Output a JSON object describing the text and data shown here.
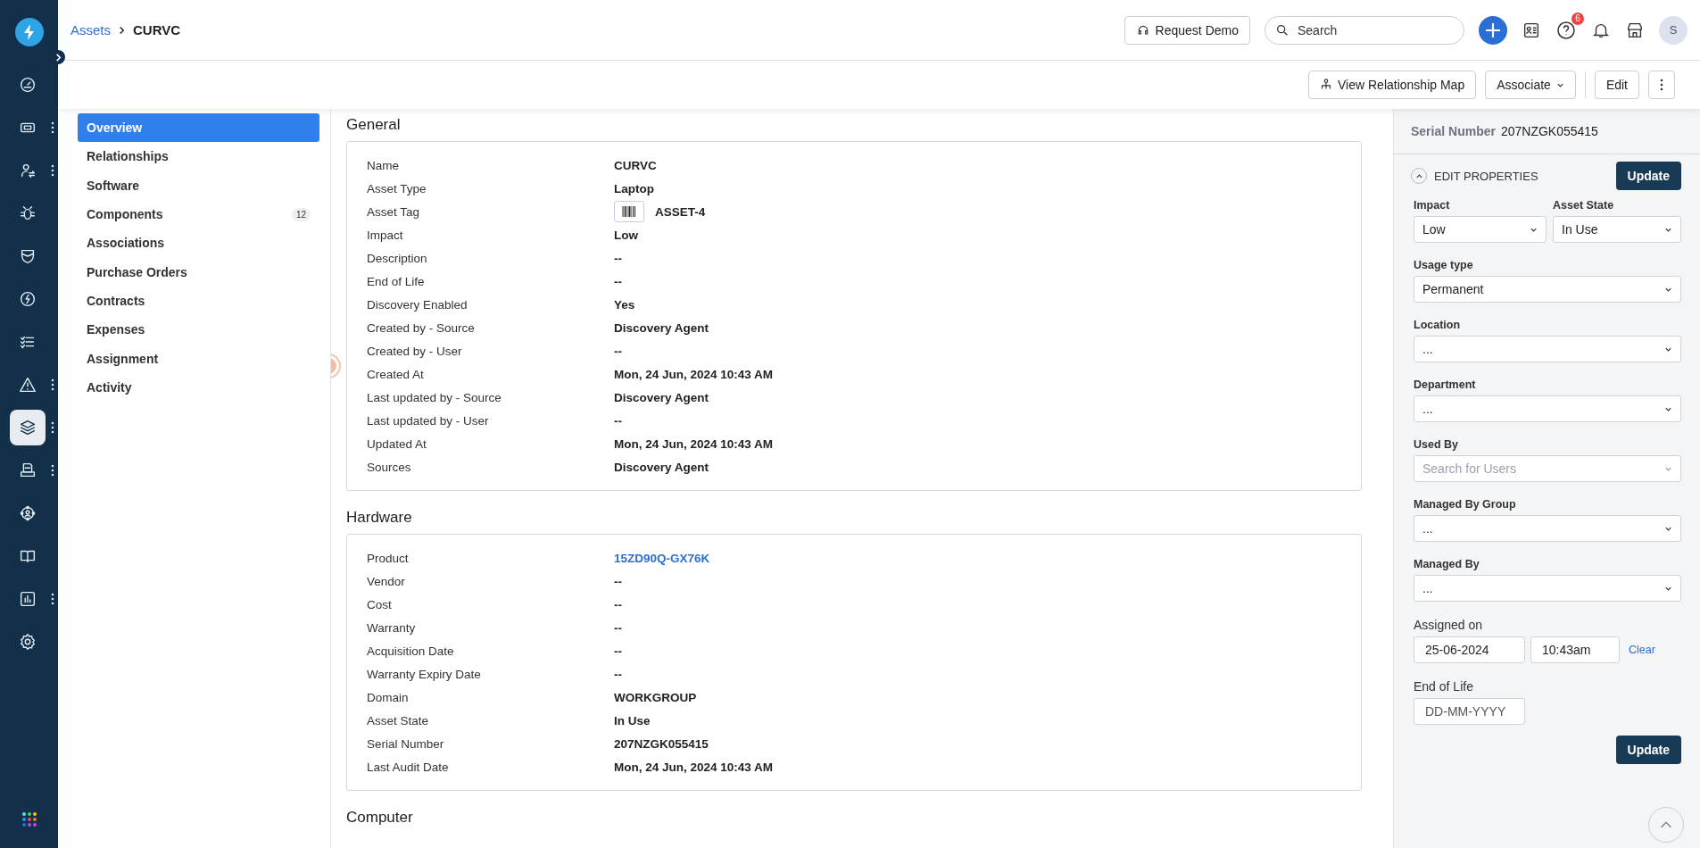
{
  "rail": {
    "items": [
      {
        "selected": false,
        "has_menu": false
      },
      {
        "selected": false,
        "has_menu": true
      },
      {
        "selected": false,
        "has_menu": true
      },
      {
        "selected": false,
        "has_menu": false
      },
      {
        "selected": false,
        "has_menu": false
      },
      {
        "selected": false,
        "has_menu": false
      },
      {
        "selected": false,
        "has_menu": false
      },
      {
        "selected": false,
        "has_menu": true
      },
      {
        "selected": true,
        "has_menu": true
      },
      {
        "selected": false,
        "has_menu": true
      },
      {
        "selected": false,
        "has_menu": false
      },
      {
        "selected": false,
        "has_menu": false
      },
      {
        "selected": false,
        "has_menu": true
      },
      {
        "selected": false,
        "has_menu": false
      }
    ]
  },
  "breadcrumb": [
    {
      "label": "Assets",
      "kind": "link"
    },
    {
      "label": "CURVC",
      "kind": "current"
    }
  ],
  "header": {
    "request_demo": "Request Demo",
    "search": {
      "placeholder": "Search"
    },
    "help_badge": "6",
    "avatar": "S"
  },
  "toolbar": {
    "buttons": [
      "View Relationship Map",
      "Associate",
      "Edit"
    ]
  },
  "subnav": [
    {
      "label": "Overview",
      "selected": true
    },
    {
      "label": "Relationships",
      "selected": false
    },
    {
      "label": "Software",
      "selected": false
    },
    {
      "label": "Components",
      "selected": false,
      "count": "12"
    },
    {
      "label": "Associations",
      "selected": false
    },
    {
      "label": "Purchase Orders",
      "selected": false
    },
    {
      "label": "Contracts",
      "selected": false
    },
    {
      "label": "Expenses",
      "selected": false
    },
    {
      "label": "Assignment",
      "selected": false
    },
    {
      "label": "Activity",
      "selected": false
    }
  ],
  "sections": [
    {
      "title": "General",
      "rows": [
        {
          "label": "Name",
          "value": "CURVC",
          "kind": "text"
        },
        {
          "label": "Asset Type",
          "value": "Laptop",
          "kind": "text"
        },
        {
          "label": "Asset Tag",
          "value": "ASSET-4",
          "kind": "tag"
        },
        {
          "label": "Impact",
          "value": "Low",
          "kind": "text"
        },
        {
          "label": "Description",
          "value": "--",
          "kind": "text"
        },
        {
          "label": "End of Life",
          "value": "--",
          "kind": "text"
        },
        {
          "label": "Discovery Enabled",
          "value": "Yes",
          "kind": "text"
        },
        {
          "label": "Created by - Source",
          "value": "Discovery Agent",
          "kind": "text"
        },
        {
          "label": "Created by - User",
          "value": "--",
          "kind": "text"
        },
        {
          "label": "Created At",
          "value": "Mon, 24 Jun, 2024 10:43 AM",
          "kind": "text"
        },
        {
          "label": "Last updated by - Source",
          "value": "Discovery Agent",
          "kind": "text"
        },
        {
          "label": "Last updated by - User",
          "value": "--",
          "kind": "text"
        },
        {
          "label": "Updated At",
          "value": "Mon, 24 Jun, 2024 10:43 AM",
          "kind": "text"
        },
        {
          "label": "Sources",
          "value": "Discovery Agent",
          "kind": "text"
        }
      ]
    },
    {
      "title": "Hardware",
      "rows": [
        {
          "label": "Product",
          "value": "15ZD90Q-GX76K",
          "kind": "link"
        },
        {
          "label": "Vendor",
          "value": "--",
          "kind": "text"
        },
        {
          "label": "Cost",
          "value": "--",
          "kind": "text"
        },
        {
          "label": "Warranty",
          "value": "--",
          "kind": "text"
        },
        {
          "label": "Acquisition Date",
          "value": "--",
          "kind": "text"
        },
        {
          "label": "Warranty Expiry Date",
          "value": "--",
          "kind": "text"
        },
        {
          "label": "Domain",
          "value": "WORKGROUP",
          "kind": "text"
        },
        {
          "label": "Asset State",
          "value": "In Use",
          "kind": "text"
        },
        {
          "label": "Serial Number",
          "value": "207NZGK055415",
          "kind": "text"
        },
        {
          "label": "Last Audit Date",
          "value": "Mon, 24 Jun, 2024 10:43 AM",
          "kind": "text"
        }
      ]
    },
    {
      "title": "Computer"
    }
  ],
  "panel": {
    "serial_label": "Serial Number",
    "serial_value": "207NZGK055415",
    "edit_title": "EDIT PROPERTIES",
    "update": "Update",
    "fields": [
      {
        "kind": "pair",
        "items": [
          {
            "label": "Impact",
            "value": "Low"
          },
          {
            "label": "Asset State",
            "value": "In Use"
          }
        ]
      },
      {
        "kind": "select",
        "label": "Usage type",
        "value": "Permanent"
      },
      {
        "kind": "select",
        "label": "Location",
        "value": "..."
      },
      {
        "kind": "select",
        "label": "Department",
        "value": "..."
      },
      {
        "kind": "select",
        "label": "Used By",
        "placeholder": "Search for Users"
      },
      {
        "kind": "select",
        "label": "Managed By Group",
        "value": "..."
      },
      {
        "kind": "select",
        "label": "Managed By",
        "value": "..."
      },
      {
        "kind": "datetime",
        "label": "Assigned on",
        "date": "25-06-2024",
        "time": "10:43am",
        "clear": "Clear"
      },
      {
        "kind": "date",
        "label": "End of Life",
        "placeholder": "DD-MM-YYYY"
      }
    ],
    "update_bottom": "Update"
  }
}
